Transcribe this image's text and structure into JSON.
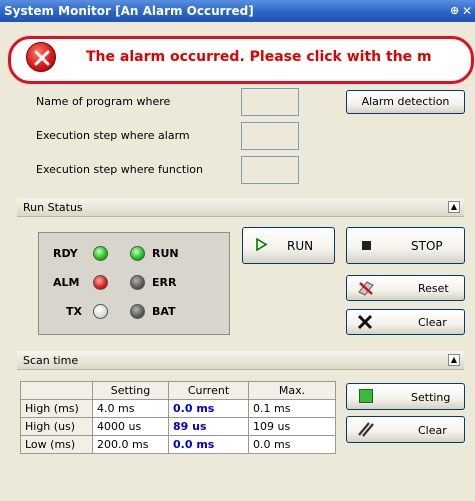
{
  "window": {
    "title": "System Monitor [An Alarm Occurred]"
  },
  "alarm": {
    "message": "The alarm occurred. Please click with the m"
  },
  "info_rows": [
    {
      "label": "Name of program where",
      "value": ""
    },
    {
      "label": "Execution step where alarm",
      "value": ""
    },
    {
      "label": "Execution step where function",
      "value": ""
    }
  ],
  "buttons": {
    "alarm_detection": "Alarm detection",
    "run": "RUN",
    "stop": "STOP",
    "reset": "Reset",
    "clear_status": "Clear",
    "setting": "Setting",
    "clear_scan": "Clear"
  },
  "run_status": {
    "header": "Run Status",
    "leds": [
      {
        "label": "RDY",
        "state": "green"
      },
      {
        "label": "RUN",
        "state": "green"
      },
      {
        "label": "ALM",
        "state": "red"
      },
      {
        "label": "ERR",
        "state": "dark"
      },
      {
        "label": "TX",
        "state": "off"
      },
      {
        "label": "BAT",
        "state": "dark"
      }
    ]
  },
  "scan_time": {
    "header": "Scan time",
    "columns": [
      "",
      "Setting",
      "Current",
      "Max."
    ],
    "rows": [
      {
        "name": "High (ms)",
        "setting": "4.0 ms",
        "current": "0.0 ms",
        "max": "0.1 ms"
      },
      {
        "name": "High (us)",
        "setting": "4000 us",
        "current": "89 us",
        "max": "109 us"
      },
      {
        "name": "Low (ms)",
        "setting": "200.0 ms",
        "current": "0.0 ms",
        "max": "0.0 ms"
      }
    ]
  },
  "colors": {
    "title_bar": "#2a64c8",
    "alarm_red": "#e00000",
    "current_value_blue": "#0000cc",
    "led_green": "#20c820",
    "led_red": "#e02020"
  }
}
